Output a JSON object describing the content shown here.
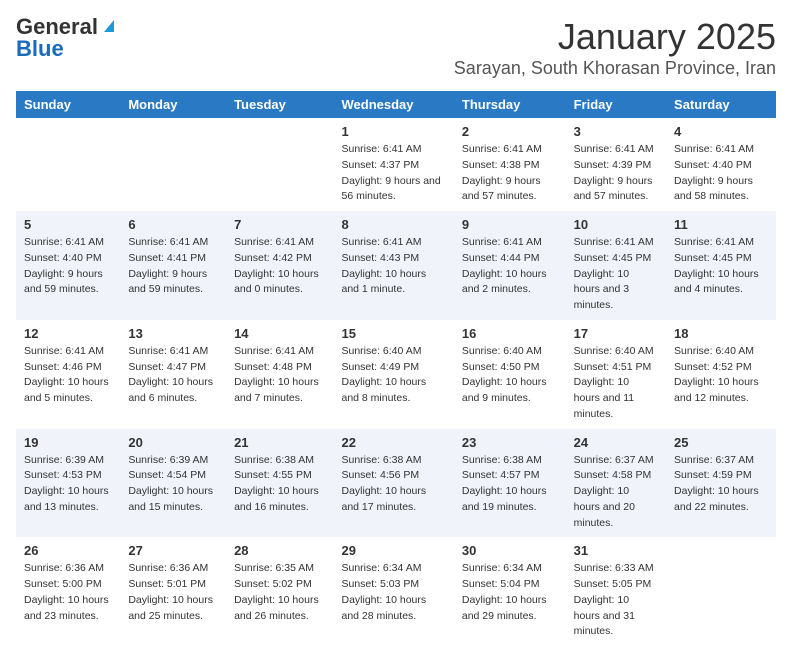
{
  "header": {
    "logo_general": "General",
    "logo_blue": "Blue",
    "title": "January 2025",
    "subtitle": "Sarayan, South Khorasan Province, Iran"
  },
  "weekdays": [
    "Sunday",
    "Monday",
    "Tuesday",
    "Wednesday",
    "Thursday",
    "Friday",
    "Saturday"
  ],
  "weeks": [
    [
      {
        "day": "",
        "info": ""
      },
      {
        "day": "",
        "info": ""
      },
      {
        "day": "",
        "info": ""
      },
      {
        "day": "1",
        "info": "Sunrise: 6:41 AM\nSunset: 4:37 PM\nDaylight: 9 hours and 56 minutes."
      },
      {
        "day": "2",
        "info": "Sunrise: 6:41 AM\nSunset: 4:38 PM\nDaylight: 9 hours and 57 minutes."
      },
      {
        "day": "3",
        "info": "Sunrise: 6:41 AM\nSunset: 4:39 PM\nDaylight: 9 hours and 57 minutes."
      },
      {
        "day": "4",
        "info": "Sunrise: 6:41 AM\nSunset: 4:40 PM\nDaylight: 9 hours and 58 minutes."
      }
    ],
    [
      {
        "day": "5",
        "info": "Sunrise: 6:41 AM\nSunset: 4:40 PM\nDaylight: 9 hours and 59 minutes."
      },
      {
        "day": "6",
        "info": "Sunrise: 6:41 AM\nSunset: 4:41 PM\nDaylight: 9 hours and 59 minutes."
      },
      {
        "day": "7",
        "info": "Sunrise: 6:41 AM\nSunset: 4:42 PM\nDaylight: 10 hours and 0 minutes."
      },
      {
        "day": "8",
        "info": "Sunrise: 6:41 AM\nSunset: 4:43 PM\nDaylight: 10 hours and 1 minute."
      },
      {
        "day": "9",
        "info": "Sunrise: 6:41 AM\nSunset: 4:44 PM\nDaylight: 10 hours and 2 minutes."
      },
      {
        "day": "10",
        "info": "Sunrise: 6:41 AM\nSunset: 4:45 PM\nDaylight: 10 hours and 3 minutes."
      },
      {
        "day": "11",
        "info": "Sunrise: 6:41 AM\nSunset: 4:45 PM\nDaylight: 10 hours and 4 minutes."
      }
    ],
    [
      {
        "day": "12",
        "info": "Sunrise: 6:41 AM\nSunset: 4:46 PM\nDaylight: 10 hours and 5 minutes."
      },
      {
        "day": "13",
        "info": "Sunrise: 6:41 AM\nSunset: 4:47 PM\nDaylight: 10 hours and 6 minutes."
      },
      {
        "day": "14",
        "info": "Sunrise: 6:41 AM\nSunset: 4:48 PM\nDaylight: 10 hours and 7 minutes."
      },
      {
        "day": "15",
        "info": "Sunrise: 6:40 AM\nSunset: 4:49 PM\nDaylight: 10 hours and 8 minutes."
      },
      {
        "day": "16",
        "info": "Sunrise: 6:40 AM\nSunset: 4:50 PM\nDaylight: 10 hours and 9 minutes."
      },
      {
        "day": "17",
        "info": "Sunrise: 6:40 AM\nSunset: 4:51 PM\nDaylight: 10 hours and 11 minutes."
      },
      {
        "day": "18",
        "info": "Sunrise: 6:40 AM\nSunset: 4:52 PM\nDaylight: 10 hours and 12 minutes."
      }
    ],
    [
      {
        "day": "19",
        "info": "Sunrise: 6:39 AM\nSunset: 4:53 PM\nDaylight: 10 hours and 13 minutes."
      },
      {
        "day": "20",
        "info": "Sunrise: 6:39 AM\nSunset: 4:54 PM\nDaylight: 10 hours and 15 minutes."
      },
      {
        "day": "21",
        "info": "Sunrise: 6:38 AM\nSunset: 4:55 PM\nDaylight: 10 hours and 16 minutes."
      },
      {
        "day": "22",
        "info": "Sunrise: 6:38 AM\nSunset: 4:56 PM\nDaylight: 10 hours and 17 minutes."
      },
      {
        "day": "23",
        "info": "Sunrise: 6:38 AM\nSunset: 4:57 PM\nDaylight: 10 hours and 19 minutes."
      },
      {
        "day": "24",
        "info": "Sunrise: 6:37 AM\nSunset: 4:58 PM\nDaylight: 10 hours and 20 minutes."
      },
      {
        "day": "25",
        "info": "Sunrise: 6:37 AM\nSunset: 4:59 PM\nDaylight: 10 hours and 22 minutes."
      }
    ],
    [
      {
        "day": "26",
        "info": "Sunrise: 6:36 AM\nSunset: 5:00 PM\nDaylight: 10 hours and 23 minutes."
      },
      {
        "day": "27",
        "info": "Sunrise: 6:36 AM\nSunset: 5:01 PM\nDaylight: 10 hours and 25 minutes."
      },
      {
        "day": "28",
        "info": "Sunrise: 6:35 AM\nSunset: 5:02 PM\nDaylight: 10 hours and 26 minutes."
      },
      {
        "day": "29",
        "info": "Sunrise: 6:34 AM\nSunset: 5:03 PM\nDaylight: 10 hours and 28 minutes."
      },
      {
        "day": "30",
        "info": "Sunrise: 6:34 AM\nSunset: 5:04 PM\nDaylight: 10 hours and 29 minutes."
      },
      {
        "day": "31",
        "info": "Sunrise: 6:33 AM\nSunset: 5:05 PM\nDaylight: 10 hours and 31 minutes."
      },
      {
        "day": "",
        "info": ""
      }
    ]
  ]
}
